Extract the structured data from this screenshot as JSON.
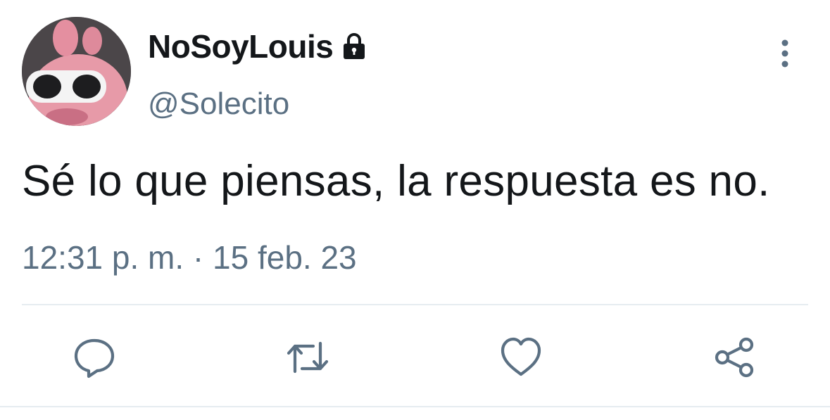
{
  "user": {
    "display_name": "NoSoyLouis",
    "handle": "@Solecito",
    "protected": true,
    "avatar_icon": "avatar-photo"
  },
  "tweet": {
    "text": "Sé lo que piensas, la respuesta es no.",
    "timestamp": "12:31 p. m. · 15 feb. 23"
  },
  "actions": {
    "reply_icon": "reply-icon",
    "retweet_icon": "retweet-icon",
    "like_icon": "heart-icon",
    "share_icon": "share-icon"
  },
  "colors": {
    "text_primary": "#14171a",
    "text_secondary": "#5b7083",
    "divider": "#e6ecf0"
  }
}
